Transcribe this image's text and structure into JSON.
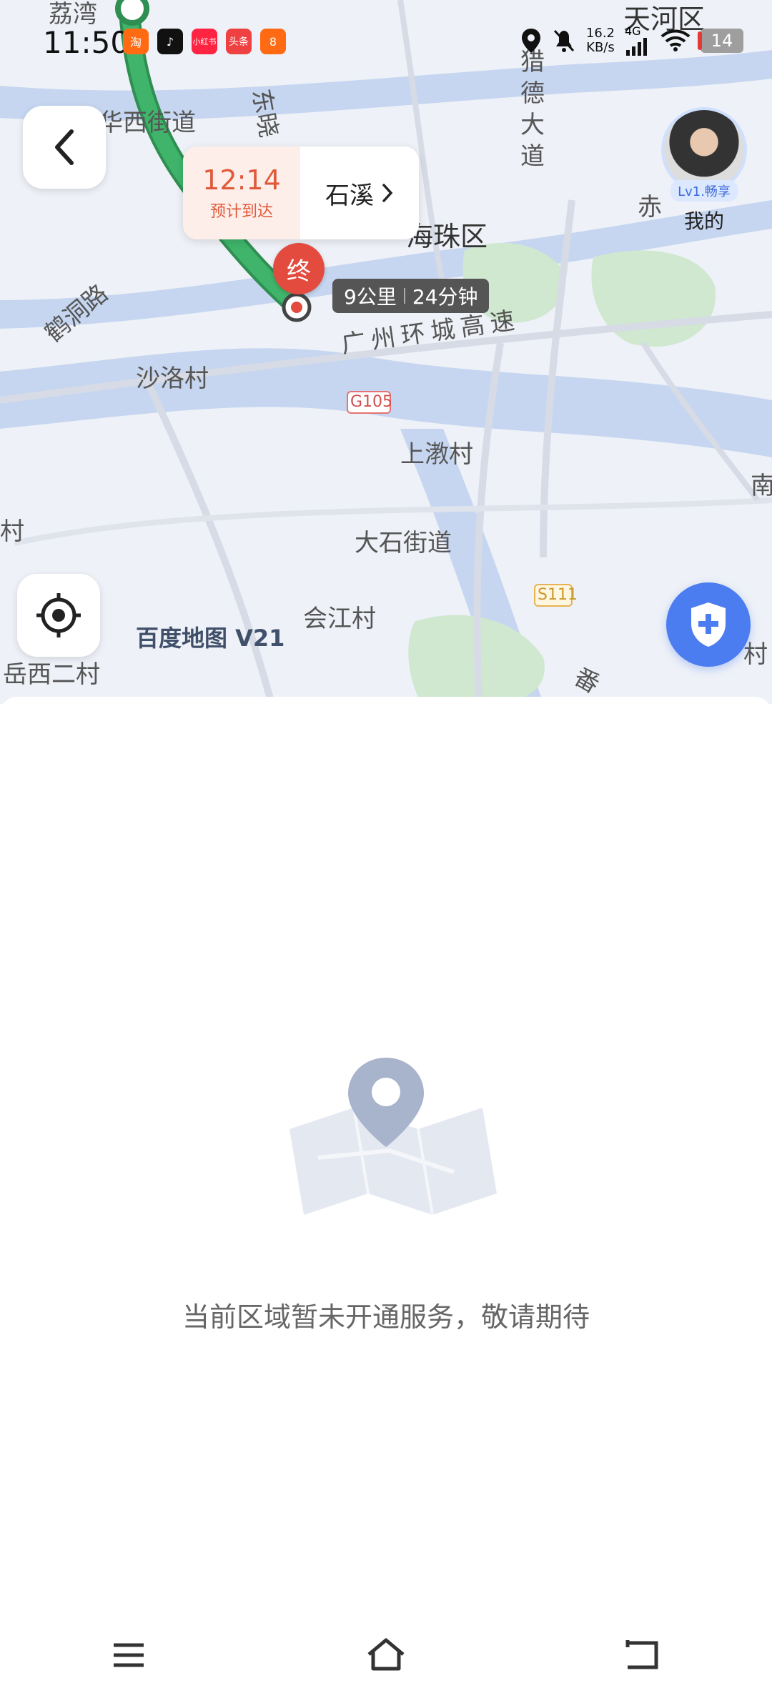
{
  "status_bar": {
    "time": "11:50",
    "apps": [
      {
        "icon": "taobao-icon",
        "label": "淘",
        "color": "#ff6a13"
      },
      {
        "icon": "tiktok-icon",
        "label": "♪",
        "color": "#111111"
      },
      {
        "icon": "xiaohongshu-icon",
        "label": "小红书",
        "color": "#ff2442"
      },
      {
        "icon": "toutiao-icon",
        "label": "头条",
        "color": "#f04142"
      },
      {
        "icon": "app-icon",
        "label": "8",
        "color": "#ff6a13"
      }
    ],
    "net_speed": "16.2",
    "net_unit": "KB/s",
    "network": "4G",
    "battery": "14"
  },
  "map": {
    "labels": {
      "lichwan": "荔湾",
      "tianhe": "天河区",
      "huaxi": "华西街道",
      "dongxiao": "东晓",
      "liede": "猎德大道",
      "haizhu": "海珠区",
      "hedong": "鹤洞路",
      "shaluo": "沙洛村",
      "ring_expy": "广州环城高速",
      "g105": "G105",
      "shangjiao": "上漖村",
      "dashi": "大石街道",
      "huijiang": "会江村",
      "s111": "S111",
      "yuexi": "岳西二村",
      "fan": "番",
      "cun_left": "村",
      "cun_right": "村",
      "nan": "南",
      "chi": "赤"
    },
    "logo": "百度地图 V21"
  },
  "eta": {
    "time": "12:14",
    "label": "预计到达",
    "destination": "石溪"
  },
  "destination_pin": "终",
  "route_info": {
    "distance": "9公里",
    "duration": "24分钟"
  },
  "profile": {
    "level": "Lv1.畅享",
    "label": "我的"
  },
  "empty_state": {
    "message": "当前区域暂未开通服务，敬请期待"
  },
  "colors": {
    "route": "#3fb46a",
    "accent": "#4b7cf0",
    "eta": "#e05a3a",
    "pin": "#e34b3e"
  }
}
